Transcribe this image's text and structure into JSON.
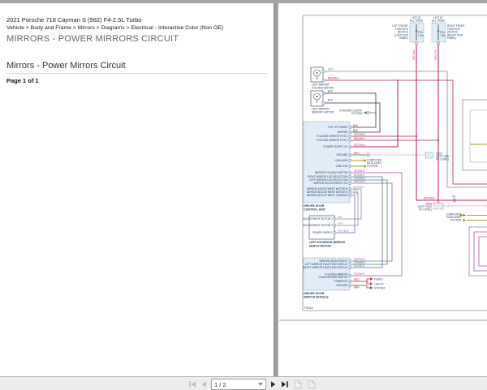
{
  "palette": {
    "wire_pink": "#e0447c",
    "wire_red": "#b5294e",
    "wire_magenta": "#cf3f9f",
    "wire_violet": "#8a5fb0",
    "wire_blue": "#5566c0",
    "wire_green": "#3f8a4f",
    "wire_olive": "#8f7d00",
    "wire_brown": "#7a4a2a",
    "module_fill": "#e2edf7",
    "label_navy": "#16355c"
  },
  "header": {
    "vehicle": "2021 Porsche 718 Cayman S (982) F4-2.5L Turbo",
    "breadcrumb": "Vehicle > Body and Frame > Mirrors > Diagrams > Electrical - Interactive Color (Non OE)",
    "title": "MIRRORS - POWER MIRRORS CIRCUIT",
    "section_title": "Mirrors - Power Mirrors Circuit",
    "page_of": "Page 1 of 1"
  },
  "toolbar": {
    "page_indicator": "1 / 2",
    "first_icon": "go-first-page",
    "prev_icon": "go-previous-page",
    "next_icon": "go-next-page",
    "last_icon": "go-last-page",
    "view_prev_icon": "previous-view",
    "view_next_icon": "next-view"
  },
  "diagram": {
    "code": "FW14",
    "hot_l1": "HOT AT",
    "hot_l2": "ALL TIMES",
    "fuseL": {
      "id": "F15",
      "amps": "7.5A",
      "loc1": "LEFT FRONT",
      "loc2": "FUSE BOX",
      "loc3": "(ROW D)",
      "loc4": "(LEFT KICK",
      "loc5": "PANEL)",
      "wire": "RED/BLK"
    },
    "fuseR": {
      "id": "F16",
      "amps": "7.5A",
      "loc1": "RIGHT FRONT",
      "loc2": "FUSE BOX",
      "loc3": "(ROW D)",
      "loc4": "(RIGHT KICK",
      "loc5": "PANEL)",
      "wire": "RED/YEL"
    },
    "comp_fold": {
      "l1": "LEFT MIRROR",
      "l2": "FOLDING MOTOR",
      "p1": "1",
      "p2": "2",
      "w1": "BRN",
      "w2": "RED/BLU"
    },
    "comp_mem": {
      "l1": "LEFT MIRROR",
      "l2": "MEMORY MOTOR",
      "p1": "1",
      "p2": "2",
      "w1": "BLK",
      "w2": "BLK"
    },
    "int_lights": {
      "l1": "INTERIOR LIGHTS",
      "l2": "SYSTEM",
      "w": "GRN"
    },
    "cu": {
      "name1": "DRIVER DOOR",
      "name2": "CONTROL UNIT",
      "p157": "TOP OF POWER",
      "p161": "MIRROR",
      "p168": "FOLDING MIRROR POS 1",
      "p173": "FOLDING MIRROR POS 2",
      "p181": "POWER SUPPLY B+",
      "p191": "GROUND",
      "p198": "CAN HIGH",
      "p205": "CAN LOW",
      "p213": "MIRROR FOLDING MOTOR",
      "p218": "RIGHT MIRROR LED SELECTION",
      "p222": "LEFT MIRROR LED SELECTION",
      "p226": "MIRROR ADJUSTMENT LED",
      "p233": "MIRROR ADJUSTMENT MOTOR A",
      "p237": "MIRROR ADJUSTMENT MOTOR B",
      "p241": "MIRROR ADJUSTMENT COMMON",
      "wblk1": "BLK",
      "wblk2": "BLK",
      "w168": "RED/BLK",
      "w173": "RED/BLK",
      "w181": "RED/BLU",
      "w191": "BRN",
      "w213": "VIO/WHT",
      "w218": "BLU/BLK",
      "w222": "GRN/BLK",
      "w226": "WHT/VIO",
      "w233": "GRY/BLU",
      "w237": "GRY",
      "w241": "VIO"
    },
    "ground1": {
      "l1": "G203",
      "l2": "(LEFT END",
      "l3": "OF COWL)"
    },
    "ground2": {
      "l1": "G503",
      "l2": "(LEFT SIDE",
      "l3": "OF COWL)"
    },
    "datalines": {
      "l1": "COMPUTER",
      "l2": "DATA LINES",
      "l3": "SYSTEM"
    },
    "connector": "X8",
    "wire_main": "RED/BLK",
    "servo": {
      "name1": "LEFT EXTERIOR MIRROR",
      "name2": "SERVO MOTOR",
      "p1": "ADJUSTMENT MOTOR 1",
      "p2": "ADJUSTMENT MOTOR 2",
      "p3": "POWER SUPPLY",
      "w1": "VIO",
      "w2": "GRY",
      "w3": "GRY/BLU"
    },
    "dm": {
      "name1": "DRIVER DOOR",
      "name2": "SWITCH MODULE",
      "p322": "MIRROR ADJUSTMENT",
      "p326": "LEFT MIRROR FUNCTION DISPLAY",
      "p330": "RIGHT MIRROR FUNCTION DISPLAY",
      "p340": "FOLDING MIRROR",
      "p343": "CHANGEOVER SWITCH",
      "p347": "POWER B+",
      "p352": "GROUND",
      "w322": "WHT/VIO",
      "w326": "GRN/BLK",
      "w330": "BLU/BLK",
      "w340": "VIO/WHT",
      "w347": "RED",
      "w352": "BRN",
      "r1": "FUSES",
      "r2": "LIGHTS",
      "r3": "SYSTEM"
    }
  }
}
